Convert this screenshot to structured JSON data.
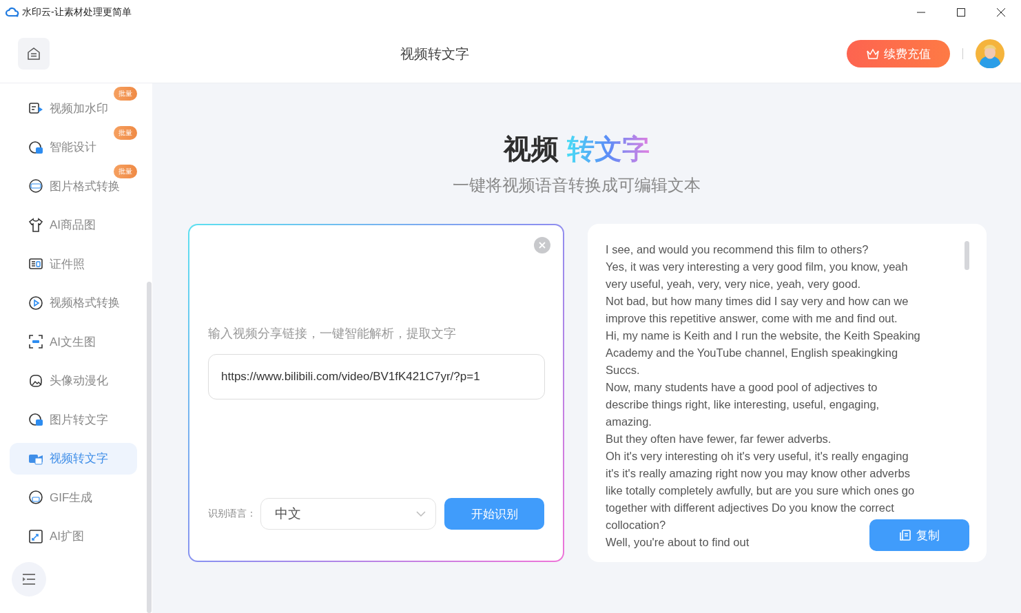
{
  "window": {
    "title": "水印云-让素材处理更简单"
  },
  "header": {
    "title": "视频转文字",
    "recharge_button": "续费充值"
  },
  "sidebar": {
    "items": [
      {
        "label": "视频加水印",
        "badge": "批量",
        "selected": false
      },
      {
        "label": "智能设计",
        "badge": "批量",
        "selected": false
      },
      {
        "label": "图片格式转换",
        "badge": "批量",
        "selected": false
      },
      {
        "label": "AI商品图",
        "selected": false
      },
      {
        "label": "证件照",
        "selected": false
      },
      {
        "label": "视频格式转换",
        "selected": false
      },
      {
        "label": "AI文生图",
        "selected": false
      },
      {
        "label": "头像动漫化",
        "selected": false
      },
      {
        "label": "图片转文字",
        "selected": false
      },
      {
        "label": "视频转文字",
        "selected": true
      },
      {
        "label": "GIF生成",
        "selected": false
      },
      {
        "label": "AI扩图",
        "selected": false
      }
    ]
  },
  "hero": {
    "title_plain": "视频",
    "title_highlight": "转文字",
    "subtitle": "一键将视频语音转换成可编辑文本"
  },
  "input_card": {
    "prompt": "输入视频分享链接，一键智能解析，提取文字",
    "url_field": {
      "value": "https://www.bilibili.com/video/BV1fK421C7yr/?p=1"
    },
    "language_label": "识别语言：",
    "language_select": {
      "value": "中文"
    },
    "start_button": "开始识别"
  },
  "result_card": {
    "lines": [
      "I see, and would you recommend this film to others?",
      "Yes, it was very interesting a very good film, you know, yeah",
      "very useful, yeah, very, very nice, yeah, very good.",
      "Not bad, but how many times did I say very and how can we",
      "improve this repetitive answer, come with me and find out.",
      "Hi, my name is Keith and I run the website, the Keith Speaking",
      "Academy and the YouTube channel, English speakingking",
      "Succs.",
      "Now, many students have a good pool of adjectives to",
      "describe things right, like interesting, useful, engaging,",
      "amazing.",
      "But they often have fewer, far fewer adverbs.",
      "Oh it's very interesting oh it's very useful, it's really engaging",
      "it's it's really amazing right now you may know other adverbs",
      "like totally completely awfully, but are you sure which ones go",
      "together with different adjectives Do you know the correct",
      "collocation?",
      "Well, you're about to find out"
    ],
    "copy_button": "复制"
  }
}
